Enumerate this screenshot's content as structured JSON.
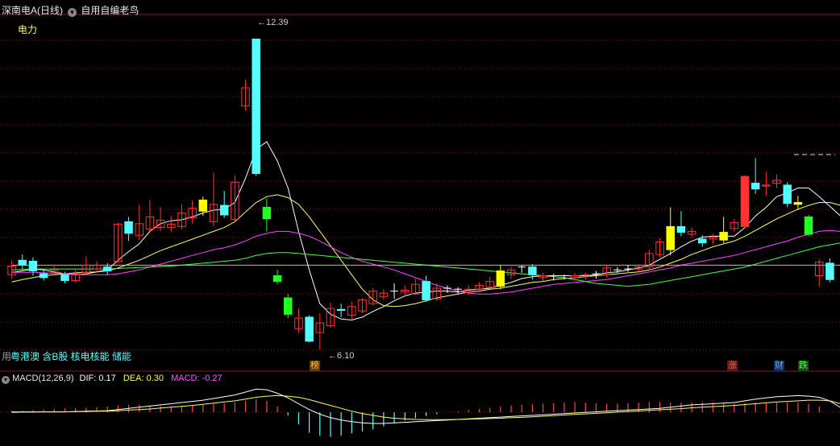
{
  "header": {
    "title": "深南电A(日线)",
    "formula": "自用自编老鸟"
  },
  "sector_label": "电力",
  "concept_labels": "粤港澳 含B股 核电核能 储能",
  "concept_prefix": "用",
  "price_annotations": {
    "high": "12.39",
    "low": "6.10"
  },
  "event_tags": [
    {
      "text": "榜",
      "color": "#ffcc00",
      "bg": "#5a3a1a"
    },
    {
      "text": "涨",
      "color": "#ff5555",
      "bg": "#5a1a1a"
    },
    {
      "text": "财",
      "color": "#66aaff",
      "bg": "#1a2a5a"
    },
    {
      "text": "跌",
      "color": "#44ff44",
      "bg": "#1a4a1a"
    }
  ],
  "macd_header": {
    "name": "MACD(12,26,9)",
    "dif": "DIF: 0.17",
    "dea": "DEA: 0.30",
    "macd": "MACD: -0.27"
  },
  "colors": {
    "up": "#ff3333",
    "down": "#54ffff",
    "down_strong": "#22ff22",
    "highlight": "#ffff00",
    "ma5": "#ffffff",
    "ma10": "#ffff66",
    "ma20": "#ff44ff",
    "ma60": "#44ff44",
    "grid": "#8b1a1a"
  },
  "chart_data": {
    "type": "candlestick",
    "ylim": [
      5.6,
      12.9
    ],
    "candles": [
      {
        "o": 7.5,
        "c": 7.68,
        "h": 7.8,
        "l": 7.42,
        "s": "up"
      },
      {
        "o": 7.8,
        "c": 7.7,
        "h": 7.92,
        "l": 7.6,
        "s": "down"
      },
      {
        "o": 7.78,
        "c": 7.58,
        "h": 7.86,
        "l": 7.48,
        "s": "down"
      },
      {
        "o": 7.52,
        "c": 7.44,
        "h": 7.62,
        "l": 7.38,
        "s": "down"
      },
      {
        "o": 7.6,
        "c": 7.54,
        "h": 7.68,
        "l": 7.48,
        "s": "up"
      },
      {
        "o": 7.5,
        "c": 7.38,
        "h": 7.56,
        "l": 7.32,
        "s": "down"
      },
      {
        "o": 7.38,
        "c": 7.52,
        "h": 7.62,
        "l": 7.34,
        "s": "up"
      },
      {
        "o": 7.55,
        "c": 7.7,
        "h": 7.88,
        "l": 7.5,
        "s": "up"
      },
      {
        "o": 7.62,
        "c": 7.7,
        "h": 7.78,
        "l": 7.56,
        "s": "up"
      },
      {
        "o": 7.66,
        "c": 7.58,
        "h": 7.74,
        "l": 7.5,
        "s": "down"
      },
      {
        "o": 7.78,
        "c": 8.55,
        "h": 8.58,
        "l": 7.74,
        "s": "up"
      },
      {
        "o": 8.6,
        "c": 8.36,
        "h": 8.7,
        "l": 8.2,
        "s": "down"
      },
      {
        "o": 8.32,
        "c": 8.56,
        "h": 8.95,
        "l": 8.22,
        "s": "up"
      },
      {
        "o": 8.45,
        "c": 8.7,
        "h": 9.05,
        "l": 8.4,
        "s": "up"
      },
      {
        "o": 8.48,
        "c": 8.63,
        "h": 8.9,
        "l": 8.4,
        "s": "up"
      },
      {
        "o": 8.55,
        "c": 8.48,
        "h": 8.72,
        "l": 8.38,
        "s": "up"
      },
      {
        "o": 8.5,
        "c": 8.78,
        "h": 8.96,
        "l": 8.44,
        "s": "up"
      },
      {
        "o": 8.68,
        "c": 8.88,
        "h": 9.04,
        "l": 8.56,
        "s": "up"
      },
      {
        "o": 9.05,
        "c": 8.82,
        "h": 9.12,
        "l": 8.72,
        "s": "yellow"
      },
      {
        "o": 8.6,
        "c": 8.96,
        "h": 9.62,
        "l": 8.5,
        "s": "up"
      },
      {
        "o": 8.94,
        "c": 8.74,
        "h": 9.24,
        "l": 8.68,
        "s": "down"
      },
      {
        "o": 8.65,
        "c": 9.42,
        "h": 9.56,
        "l": 8.6,
        "s": "up"
      },
      {
        "o": 11.0,
        "c": 11.38,
        "h": 11.55,
        "l": 10.9,
        "s": "up"
      },
      {
        "o": 9.6,
        "c": 12.39,
        "h": 12.39,
        "l": 9.55,
        "s": "down"
      },
      {
        "o": 8.9,
        "c": 8.66,
        "h": 9.08,
        "l": 8.4,
        "s": "down_strong"
      },
      {
        "o": 7.48,
        "c": 7.36,
        "h": 7.6,
        "l": 7.3,
        "s": "down_strong"
      },
      {
        "o": 7.02,
        "c": 6.68,
        "h": 7.1,
        "l": 6.6,
        "s": "down_strong"
      },
      {
        "o": 6.38,
        "c": 6.6,
        "h": 6.8,
        "l": 6.3,
        "s": "up"
      },
      {
        "o": 6.62,
        "c": 6.12,
        "h": 6.66,
        "l": 6.1,
        "s": "down"
      },
      {
        "o": 6.3,
        "c": 6.5,
        "h": 6.7,
        "l": 5.95,
        "s": "up"
      },
      {
        "o": 6.44,
        "c": 6.8,
        "h": 6.92,
        "l": 6.4,
        "s": "up"
      },
      {
        "o": 6.78,
        "c": 6.76,
        "h": 6.9,
        "l": 6.62,
        "s": "down"
      },
      {
        "o": 6.66,
        "c": 6.84,
        "h": 6.94,
        "l": 6.58,
        "s": "up"
      },
      {
        "o": 6.75,
        "c": 6.98,
        "h": 7.02,
        "l": 6.7,
        "s": "up"
      },
      {
        "o": 6.9,
        "c": 7.16,
        "h": 7.22,
        "l": 6.86,
        "s": "up"
      },
      {
        "o": 7.04,
        "c": 7.12,
        "h": 7.2,
        "l": 6.98,
        "s": "up"
      },
      {
        "o": 7.1,
        "c": 7.16,
        "h": 7.32,
        "l": 7.0,
        "s": "cross"
      },
      {
        "o": 7.18,
        "c": 7.14,
        "h": 7.28,
        "l": 7.04,
        "s": "up"
      },
      {
        "o": 7.1,
        "c": 7.3,
        "h": 7.42,
        "l": 7.08,
        "s": "up"
      },
      {
        "o": 7.36,
        "c": 6.98,
        "h": 7.48,
        "l": 6.94,
        "s": "down"
      },
      {
        "o": 7.0,
        "c": 7.22,
        "h": 7.32,
        "l": 6.96,
        "s": "up"
      },
      {
        "o": 7.18,
        "c": 7.22,
        "h": 7.28,
        "l": 7.12,
        "s": "cross"
      },
      {
        "o": 7.18,
        "c": 7.2,
        "h": 7.24,
        "l": 7.1,
        "s": "cross"
      },
      {
        "o": 7.14,
        "c": 7.2,
        "h": 7.28,
        "l": 7.08,
        "s": "up"
      },
      {
        "o": 7.2,
        "c": 7.28,
        "h": 7.34,
        "l": 7.14,
        "s": "up"
      },
      {
        "o": 7.24,
        "c": 7.36,
        "h": 7.46,
        "l": 7.2,
        "s": "up"
      },
      {
        "o": 7.58,
        "c": 7.26,
        "h": 7.7,
        "l": 7.2,
        "s": "yellow"
      },
      {
        "o": 7.5,
        "c": 7.6,
        "h": 7.66,
        "l": 7.42,
        "s": "up"
      },
      {
        "o": 7.62,
        "c": 7.66,
        "h": 7.7,
        "l": 7.54,
        "s": "cross"
      },
      {
        "o": 7.66,
        "c": 7.5,
        "h": 7.72,
        "l": 7.4,
        "s": "down"
      },
      {
        "o": 7.44,
        "c": 7.48,
        "h": 7.54,
        "l": 7.36,
        "s": "up"
      },
      {
        "o": 7.44,
        "c": 7.48,
        "h": 7.52,
        "l": 7.38,
        "s": "cross"
      },
      {
        "o": 7.44,
        "c": 7.48,
        "h": 7.5,
        "l": 7.4,
        "s": "cross"
      },
      {
        "o": 7.44,
        "c": 7.48,
        "h": 7.54,
        "l": 7.38,
        "s": "up"
      },
      {
        "o": 7.46,
        "c": 7.5,
        "h": 7.54,
        "l": 7.4,
        "s": "up"
      },
      {
        "o": 7.5,
        "c": 7.52,
        "h": 7.58,
        "l": 7.42,
        "s": "cross"
      },
      {
        "o": 7.5,
        "c": 7.64,
        "h": 7.68,
        "l": 7.44,
        "s": "up"
      },
      {
        "o": 7.58,
        "c": 7.6,
        "h": 7.66,
        "l": 7.54,
        "s": "cross"
      },
      {
        "o": 7.6,
        "c": 7.62,
        "h": 7.7,
        "l": 7.56,
        "s": "cross"
      },
      {
        "o": 7.62,
        "c": 7.66,
        "h": 7.72,
        "l": 7.56,
        "s": "up"
      },
      {
        "o": 7.66,
        "c": 7.94,
        "h": 8.02,
        "l": 7.6,
        "s": "up"
      },
      {
        "o": 7.92,
        "c": 8.18,
        "h": 8.26,
        "l": 7.86,
        "s": "up"
      },
      {
        "o": 8.5,
        "c": 8.02,
        "h": 8.9,
        "l": 7.9,
        "s": "yellow"
      },
      {
        "o": 8.38,
        "c": 8.5,
        "h": 8.82,
        "l": 8.3,
        "s": "down"
      },
      {
        "o": 8.4,
        "c": 8.34,
        "h": 8.48,
        "l": 8.28,
        "s": "up"
      },
      {
        "o": 8.24,
        "c": 8.16,
        "h": 8.32,
        "l": 8.08,
        "s": "down"
      },
      {
        "o": 8.24,
        "c": 8.28,
        "h": 8.34,
        "l": 8.14,
        "s": "up"
      },
      {
        "o": 8.38,
        "c": 8.22,
        "h": 8.7,
        "l": 8.16,
        "s": "yellow"
      },
      {
        "o": 8.46,
        "c": 8.58,
        "h": 8.66,
        "l": 8.4,
        "s": "up"
      },
      {
        "o": 8.5,
        "c": 9.54,
        "h": 9.56,
        "l": 8.46,
        "s": "up"
      },
      {
        "o": 9.4,
        "c": 9.28,
        "h": 9.92,
        "l": 9.18,
        "s": "down"
      },
      {
        "o": 9.36,
        "c": 9.34,
        "h": 9.64,
        "l": 9.14,
        "s": "up"
      },
      {
        "o": 9.46,
        "c": 9.4,
        "h": 9.58,
        "l": 9.3,
        "s": "up"
      },
      {
        "o": 9.36,
        "c": 8.98,
        "h": 9.42,
        "l": 8.9,
        "s": "down"
      },
      {
        "o": 9.0,
        "c": 8.96,
        "h": 9.14,
        "l": 8.84,
        "s": "yellow"
      },
      {
        "o": 8.7,
        "c": 8.34,
        "h": 8.74,
        "l": 8.3,
        "s": "down_strong"
      },
      {
        "o": 7.48,
        "c": 7.76,
        "h": 7.82,
        "l": 7.26,
        "s": "up"
      },
      {
        "o": 7.74,
        "c": 7.4,
        "h": 7.84,
        "l": 7.34,
        "s": "down"
      }
    ],
    "ma_lines": {
      "ma5": [
        7.55,
        7.58,
        7.62,
        7.6,
        7.56,
        7.52,
        7.5,
        7.52,
        7.56,
        7.6,
        7.8,
        7.98,
        8.14,
        8.4,
        8.56,
        8.62,
        8.64,
        8.7,
        8.78,
        8.84,
        8.86,
        9.0,
        9.5,
        10.1,
        10.26,
        9.86,
        9.3,
        8.4,
        7.6,
        6.9,
        6.68,
        6.58,
        6.56,
        6.62,
        6.74,
        6.84,
        6.96,
        7.06,
        7.12,
        7.14,
        7.16,
        7.16,
        7.14,
        7.18,
        7.2,
        7.22,
        7.28,
        7.34,
        7.42,
        7.46,
        7.48,
        7.48,
        7.48,
        7.48,
        7.48,
        7.5,
        7.54,
        7.56,
        7.6,
        7.64,
        7.7,
        7.82,
        7.94,
        8.08,
        8.2,
        8.28,
        8.3,
        8.3,
        8.3,
        8.48,
        8.72,
        8.9,
        9.12,
        9.2,
        9.3,
        9.3,
        9.12,
        8.92,
        8.72
      ],
      "ma10": [
        7.35,
        7.4,
        7.44,
        7.48,
        7.5,
        7.52,
        7.54,
        7.55,
        7.56,
        7.58,
        7.64,
        7.72,
        7.8,
        7.9,
        8.0,
        8.08,
        8.16,
        8.24,
        8.32,
        8.4,
        8.48,
        8.6,
        8.8,
        9.0,
        9.12,
        9.16,
        9.1,
        8.96,
        8.7,
        8.4,
        8.1,
        7.8,
        7.5,
        7.2,
        6.98,
        6.86,
        6.84,
        6.86,
        6.9,
        6.96,
        7.02,
        7.06,
        7.1,
        7.14,
        7.16,
        7.2,
        7.22,
        7.26,
        7.3,
        7.34,
        7.36,
        7.4,
        7.42,
        7.44,
        7.46,
        7.48,
        7.5,
        7.52,
        7.54,
        7.56,
        7.6,
        7.66,
        7.74,
        7.82,
        7.92,
        8.0,
        8.08,
        8.14,
        8.2,
        8.3,
        8.42,
        8.54,
        8.66,
        8.76,
        8.86,
        8.94,
        9.0,
        9.0,
        8.94
      ],
      "ma20": [
        7.55,
        7.55,
        7.55,
        7.54,
        7.53,
        7.52,
        7.51,
        7.5,
        7.5,
        7.5,
        7.52,
        7.56,
        7.6,
        7.66,
        7.72,
        7.78,
        7.84,
        7.9,
        7.96,
        8.02,
        8.06,
        8.12,
        8.2,
        8.3,
        8.36,
        8.4,
        8.4,
        8.36,
        8.3,
        8.2,
        8.08,
        7.96,
        7.86,
        7.78,
        7.72,
        7.66,
        7.6,
        7.52,
        7.44,
        7.36,
        7.28,
        7.22,
        7.16,
        7.12,
        7.1,
        7.1,
        7.12,
        7.14,
        7.18,
        7.22,
        7.26,
        7.3,
        7.32,
        7.34,
        7.36,
        7.38,
        7.4,
        7.44,
        7.48,
        7.52,
        7.56,
        7.6,
        7.64,
        7.7,
        7.74,
        7.78,
        7.82,
        7.86,
        7.9,
        7.96,
        8.02,
        8.08,
        8.14,
        8.2,
        8.28,
        8.34,
        8.4,
        8.42,
        8.4
      ],
      "ma60": [
        7.6,
        7.61,
        7.62,
        7.62,
        7.62,
        7.62,
        7.62,
        7.62,
        7.62,
        7.62,
        7.63,
        7.64,
        7.65,
        7.66,
        7.67,
        7.68,
        7.7,
        7.72,
        7.74,
        7.76,
        7.78,
        7.8,
        7.84,
        7.9,
        7.94,
        7.96,
        7.96,
        7.94,
        7.92,
        7.9,
        7.88,
        7.86,
        7.84,
        7.82,
        7.8,
        7.78,
        7.76,
        7.74,
        7.72,
        7.7,
        7.68,
        7.66,
        7.64,
        7.62,
        7.6,
        7.58,
        7.56,
        7.54,
        7.52,
        7.5,
        7.48,
        7.46,
        7.44,
        7.4,
        7.36,
        7.32,
        7.3,
        7.28,
        7.26,
        7.28,
        7.3,
        7.34,
        7.38,
        7.42,
        7.46,
        7.5,
        7.54,
        7.58,
        7.62,
        7.66,
        7.72,
        7.78,
        7.84,
        7.9,
        7.96,
        8.02,
        8.08,
        8.12,
        8.16
      ],
      "ref": [
        7.7,
        7.7,
        7.7,
        7.7,
        7.7,
        7.7,
        7.7,
        7.7,
        7.7,
        7.7,
        7.7,
        7.7,
        7.7,
        7.7,
        7.7,
        7.7,
        7.7,
        7.7,
        7.7,
        7.7,
        7.7,
        7.7,
        7.7,
        7.7,
        7.7,
        7.7,
        7.7,
        7.7,
        7.7,
        7.7,
        7.7,
        7.7,
        7.7,
        7.7,
        7.7,
        7.7,
        7.7,
        7.7,
        7.7,
        7.7,
        7.7,
        7.7,
        7.7,
        7.7,
        7.7,
        7.7,
        7.7,
        7.7,
        7.7,
        7.7,
        7.7,
        7.7,
        7.7,
        7.7,
        7.7,
        7.7,
        7.7,
        7.7,
        7.7,
        7.7,
        7.7,
        7.7,
        7.7,
        7.7,
        7.7,
        7.7,
        7.7,
        7.7,
        7.7,
        7.7,
        7.7,
        7.7,
        7.7,
        7.7,
        7.7,
        7.7,
        7.7,
        7.7,
        7.7
      ]
    },
    "macd": {
      "ylim": [
        -1.1,
        0.95
      ],
      "dif": [
        0.0,
        0.01,
        0.01,
        0.02,
        0.02,
        0.02,
        0.03,
        0.04,
        0.05,
        0.06,
        0.1,
        0.14,
        0.18,
        0.22,
        0.26,
        0.3,
        0.34,
        0.38,
        0.42,
        0.48,
        0.54,
        0.6,
        0.7,
        0.8,
        0.78,
        0.66,
        0.5,
        0.3,
        0.1,
        -0.06,
        -0.18,
        -0.26,
        -0.32,
        -0.36,
        -0.38,
        -0.38,
        -0.36,
        -0.34,
        -0.32,
        -0.3,
        -0.28,
        -0.26,
        -0.24,
        -0.22,
        -0.2,
        -0.18,
        -0.16,
        -0.14,
        -0.12,
        -0.1,
        -0.08,
        -0.06,
        -0.04,
        -0.02,
        0.0,
        0.02,
        0.04,
        0.06,
        0.08,
        0.1,
        0.12,
        0.14,
        0.18,
        0.22,
        0.26,
        0.28,
        0.3,
        0.32,
        0.34,
        0.4,
        0.46,
        0.5,
        0.54,
        0.56,
        0.58,
        0.56,
        0.52,
        0.4,
        0.17
      ],
      "dea": [
        0.02,
        0.02,
        0.02,
        0.02,
        0.02,
        0.02,
        0.03,
        0.03,
        0.04,
        0.04,
        0.06,
        0.08,
        0.1,
        0.12,
        0.15,
        0.18,
        0.21,
        0.24,
        0.28,
        0.32,
        0.36,
        0.4,
        0.46,
        0.52,
        0.56,
        0.58,
        0.56,
        0.52,
        0.44,
        0.34,
        0.24,
        0.14,
        0.04,
        -0.04,
        -0.1,
        -0.16,
        -0.2,
        -0.22,
        -0.24,
        -0.25,
        -0.25,
        -0.25,
        -0.24,
        -0.23,
        -0.22,
        -0.21,
        -0.2,
        -0.18,
        -0.17,
        -0.15,
        -0.13,
        -0.11,
        -0.09,
        -0.07,
        -0.05,
        -0.03,
        -0.01,
        0.01,
        0.03,
        0.05,
        0.07,
        0.09,
        0.11,
        0.13,
        0.16,
        0.18,
        0.2,
        0.22,
        0.24,
        0.27,
        0.3,
        0.33,
        0.36,
        0.38,
        0.4,
        0.42,
        0.42,
        0.4,
        0.3
      ],
      "hist": [
        0.05,
        0.06,
        0.08,
        0.1,
        0.12,
        0.14,
        0.15,
        0.16,
        0.18,
        0.2,
        0.24,
        0.26,
        0.26,
        0.24,
        0.22,
        0.2,
        0.22,
        0.24,
        0.26,
        0.3,
        0.32,
        0.34,
        0.4,
        0.46,
        0.4,
        0.2,
        -0.1,
        -0.4,
        -0.7,
        -0.8,
        -0.84,
        -0.8,
        -0.72,
        -0.66,
        -0.58,
        -0.48,
        -0.38,
        -0.28,
        -0.2,
        -0.12,
        -0.06,
        0.0,
        0.04,
        0.08,
        0.12,
        0.16,
        0.2,
        0.24,
        0.26,
        0.28,
        0.3,
        0.32,
        0.34,
        0.36,
        0.34,
        0.32,
        0.3,
        0.3,
        0.32,
        0.34,
        0.36,
        0.36,
        0.34,
        0.34,
        0.34,
        0.34,
        0.34,
        0.32,
        0.3,
        0.32,
        0.34,
        0.34,
        0.34,
        0.34,
        0.34,
        0.3,
        0.2,
        0.0,
        -0.27
      ]
    }
  }
}
